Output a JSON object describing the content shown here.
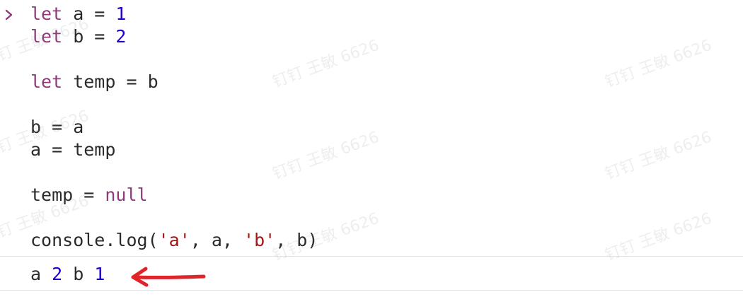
{
  "console": {
    "input_lines": [
      [
        {
          "t": "let",
          "c": "kw"
        },
        {
          "t": " a = ",
          "c": ""
        },
        {
          "t": "1",
          "c": "num"
        }
      ],
      [
        {
          "t": "let",
          "c": "kw"
        },
        {
          "t": " b = ",
          "c": ""
        },
        {
          "t": "2",
          "c": "num"
        }
      ],
      [],
      [
        {
          "t": "let",
          "c": "kw"
        },
        {
          "t": " temp = b",
          "c": ""
        }
      ],
      [],
      [
        {
          "t": "b = a",
          "c": ""
        }
      ],
      [
        {
          "t": "a = temp",
          "c": ""
        }
      ],
      [],
      [
        {
          "t": "temp = ",
          "c": ""
        },
        {
          "t": "null",
          "c": "null"
        }
      ],
      [],
      [
        {
          "t": "console.log(",
          "c": ""
        },
        {
          "t": "'a'",
          "c": "str"
        },
        {
          "t": ", a, ",
          "c": ""
        },
        {
          "t": "'b'",
          "c": "str"
        },
        {
          "t": ", b)",
          "c": ""
        }
      ]
    ],
    "output": {
      "tokens": [
        {
          "t": "a ",
          "c": ""
        },
        {
          "t": "2",
          "c": "num"
        },
        {
          "t": " b ",
          "c": ""
        },
        {
          "t": "1",
          "c": "num"
        }
      ]
    }
  },
  "watermark": {
    "text": "钉钉 王敏 6626"
  },
  "colors": {
    "keyword": "#8e3a7b",
    "number": "#1c00cf",
    "string": "#a31515",
    "arrow": "#e0242a"
  }
}
